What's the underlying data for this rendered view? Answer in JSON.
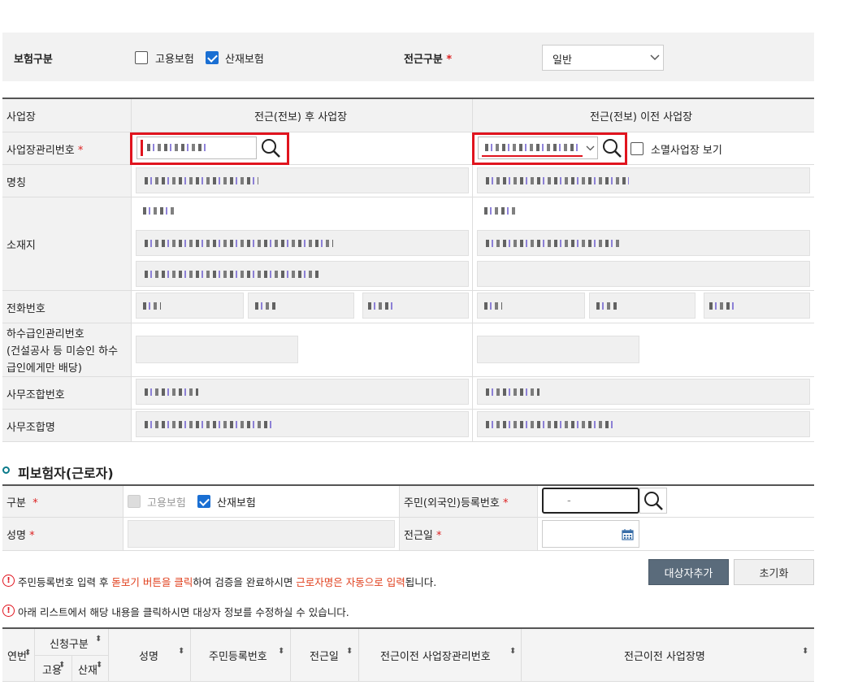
{
  "top": {
    "insurance_type_label": "보험구분",
    "employment_ins": "고용보험",
    "industrial_ins": "산재보험",
    "transfer_type_label": "전근구분",
    "transfer_type_value": "일반"
  },
  "workplace": {
    "col_label": "사업장",
    "col_after": "전근(전보) 후 사업장",
    "col_before": "전근(전보) 이전 사업장",
    "mgmt_no_label": "사업장관리번호",
    "closed_view_label": "소멸사업장 보기",
    "name_label": "명칭",
    "address_label": "소재지",
    "phone_label": "전화번호",
    "sub_mgmt_label_1": "하수급인관리번호",
    "sub_mgmt_label_2": "(건설공사 등 미승인 하수",
    "sub_mgmt_label_3": "급인에게만 배당)",
    "office_no_label": "사무조합번호",
    "office_name_label": "사무조합명"
  },
  "insured": {
    "section_title": "피보험자(근로자)",
    "type_label": "구분",
    "employment_ins": "고용보험",
    "industrial_ins": "산재보험",
    "rrn_label": "주민(외국인)등록번호",
    "rrn_value": "-",
    "name_label": "성명",
    "transfer_date_label": "전근일"
  },
  "notices": {
    "n1_a": "주민등록번호 입력 후 ",
    "n1_b": "돋보기 버튼을 클릭",
    "n1_c": "하여 검증을 완료하시면 ",
    "n1_d": "근로자명은 자동으로 입력",
    "n1_e": "됩니다.",
    "n2": "아래 리스트에서 해당 내용을 클릭하시면 대상자 정보를 수정하실 수 있습니다."
  },
  "buttons": {
    "add_target": "대상자추가",
    "reset": "초기화"
  },
  "table": {
    "col_no": "연번",
    "col_apply_type": "신청구분",
    "col_employment": "고용",
    "col_industrial": "산재",
    "col_name": "성명",
    "col_rrn": "주민등록번호",
    "col_transfer_date": "전근일",
    "col_prev_mgmt_no": "전근이전 사업장관리번호",
    "col_prev_name": "전근이전 사업장명"
  },
  "colors": {
    "accent_red": "#e0141e",
    "checkbox_blue": "#1a6fd3",
    "button_dark": "#5a6b7b",
    "section_dot": "#0a7a8a"
  }
}
